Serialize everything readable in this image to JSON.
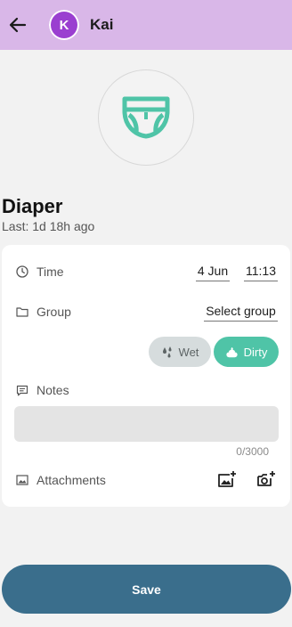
{
  "header": {
    "child_name": "Kai",
    "avatar_letter": "K"
  },
  "activity": {
    "title": "Diaper",
    "last": "Last: 1d 18h ago",
    "icon": "diaper-icon"
  },
  "time": {
    "label": "Time",
    "date": "4 Jun",
    "clock": "11:13"
  },
  "group": {
    "label": "Group",
    "value": "Select group"
  },
  "type_options": [
    {
      "label": "Wet",
      "selected": false
    },
    {
      "label": "Dirty",
      "selected": true
    }
  ],
  "notes": {
    "label": "Notes",
    "value": "",
    "counter": "0/3000"
  },
  "attachments": {
    "label": "Attachments"
  },
  "save": {
    "label": "Save"
  },
  "colors": {
    "appbar": "#d9b7e8",
    "avatar": "#9a3fd0",
    "accent_green": "#4fc4a7",
    "save_button": "#3a6e8c"
  }
}
